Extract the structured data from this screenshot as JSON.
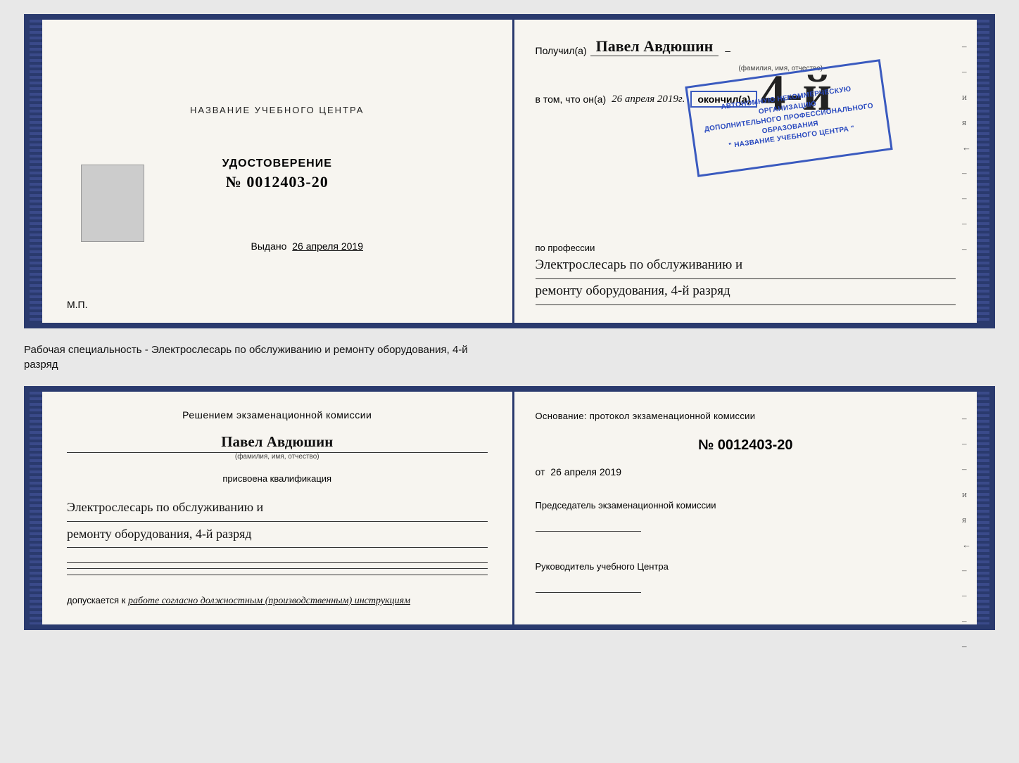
{
  "top_doc": {
    "left": {
      "center_title": "НАЗВАНИЕ УЧЕБНОГО ЦЕНТРА",
      "udostoverenie_label": "УДОСТОВЕРЕНИЕ",
      "number": "№ 0012403-20",
      "vydano_label": "Выдано",
      "vydano_date": "26 апреля 2019",
      "mp_label": "М.П."
    },
    "right": {
      "poluchil_label": "Получил(a)",
      "name": "Павел Авдюшин",
      "name_hint": "(фамилия, имя, отчество)",
      "vtom_label": "в том, что он(a)",
      "date_handwritten": "26 апреля 2019г.",
      "okonchil_label": "окончил(a)",
      "rank": "4-й",
      "org_line1": "АВТОНОМНУЮ НЕКОММЕРЧЕСКУЮ ОРГАНИЗАЦИЮ",
      "org_line2": "ДОПОЛНИТЕЛЬНОГО ПРОФЕССИОНАЛЬНОГО ОБРАЗОВАНИЯ",
      "org_line3": "\" НАЗВАНИЕ УЧЕБНОГО ЦЕНТРА \"",
      "po_professii_label": "по профессии",
      "profession_line1": "Электрослесарь по обслуживанию и",
      "profession_line2": "ремонту оборудования, 4-й разряд"
    }
  },
  "separator": {
    "text_line1": "Рабочая специальность - Электрослесарь по обслуживанию и ремонту оборудования, 4-й",
    "text_line2": "разряд"
  },
  "bottom_doc": {
    "left": {
      "komissia_title": "Решением экзаменационной комиссии",
      "name": "Павел Авдюшин",
      "name_hint": "(фамилия, имя, отчество)",
      "prisvoena_label": "присвоена квалификация",
      "qual_line1": "Электрослесарь по обслуживанию и",
      "qual_line2": "ремонту оборудования, 4-й разряд",
      "dopuskaetsya_label": "допускается к",
      "dopuskaetsya_value": "работе согласно должностным (производственным) инструкциям"
    },
    "right": {
      "osnovanie_label": "Основание: протокол экзаменационной комиссии",
      "protocol_number": "№ 0012403-20",
      "ot_label": "от",
      "ot_date": "26 апреля 2019",
      "predsedatel_label": "Председатель экзаменационной комиссии",
      "rukovoditel_label": "Руководитель учебного Центра"
    }
  },
  "side_labels": {
    "i": "и",
    "ya": "я",
    "arrow": "←",
    "dashes": [
      "–",
      "–",
      "–",
      "–",
      "–",
      "–",
      "–",
      "–"
    ]
  }
}
